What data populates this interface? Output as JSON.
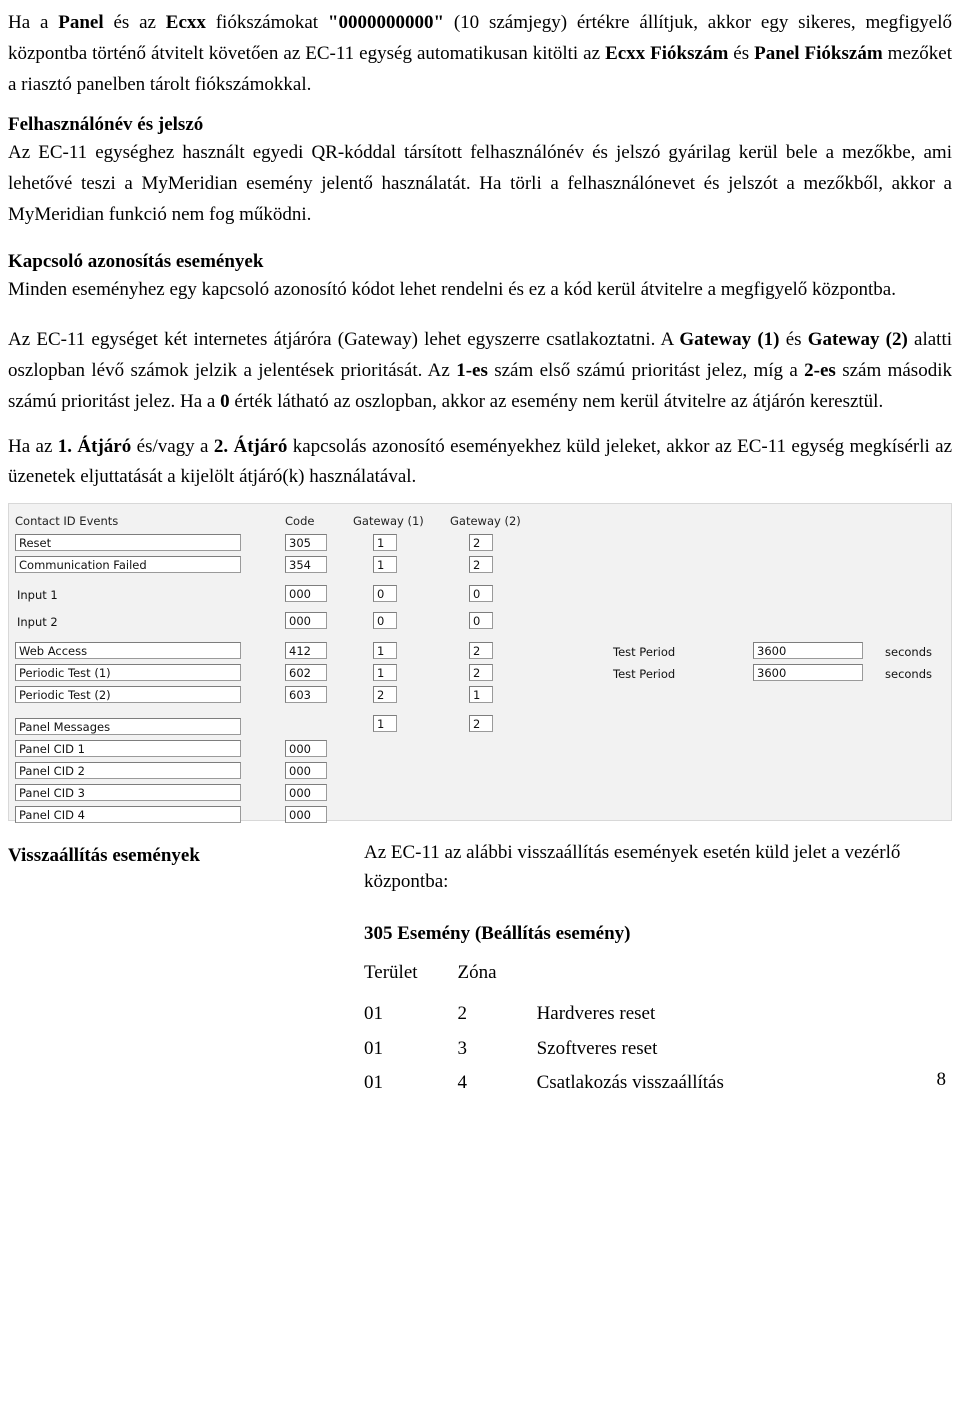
{
  "document": {
    "paragraphs": [
      {
        "id": "p1",
        "html": "Ha a <b>Panel</b> és az <b>Ecxx</b> fiókszámokat <b>\"0000000000\"</b> (10 számjegy) értékre állítjuk, akkor egy sikeres, megfigyelő központba történő átvitelt követően az EC-11 egység automatikusan kitölti az <b>Ecxx Fiókszám</b> és <b>Panel Fiókszám</b> mezőket a riasztó panelben tárolt fiókszámokkal."
      }
    ],
    "headings": {
      "username_password": "Felhasználónév és jelszó",
      "switch_ident_events": "Kapcsoló azonosítás események"
    },
    "sections": {
      "username_password_body": "Az EC-11 egységhez használt egyedi QR-kóddal társított felhasználónév és jelszó gyárilag kerül bele a mezőkbe, ami lehetővé teszi a MyMeridian esemény jelentő használatát. Ha törli a felhasználónevet és jelszót a mezőkből, akkor a MyMeridian funkció nem fog működni.",
      "switch_ident_body": "Minden eseményhez egy kapcsoló azonosító kódot lehet rendelni és ez a kód kerül átvitelre a megfigyelő központba.",
      "gateway_para_html": "Az EC-11 egységet két internetes átjáróra (Gateway) lehet egyszerre csatlakoztatni. A <b>Gateway (1)</b> és <b>Gateway (2)</b> alatti oszlopban lévő számok jelzik a jelentések prioritását. Az <b>1-es</b> szám első számú prioritást jelez, míg a <b>2-es</b> szám második számú prioritást jelez. Ha a <b>0</b> érték látható az oszlopban, akkor az esemény nem kerül átvitelre az átjárón keresztül.",
      "gateway_para2_html": "Ha az <b>1. Átjáró</b> és/vagy a <b>2. Átjáró</b> kapcsolás azonosító eseményekhez küld jeleket, akkor az EC-11 egység megkísérli az üzenetek eljuttatását a kijelölt átjáró(k) használatával."
    }
  },
  "figure": {
    "columns": {
      "contact_id_events": "Contact ID Events",
      "code": "Code",
      "gateway1": "Gateway (1)",
      "gateway2": "Gateway (2)"
    },
    "rows": [
      {
        "label": "Reset",
        "code": "305",
        "g1": "1",
        "g2": "2",
        "boxed": true
      },
      {
        "label": "Communication Failed",
        "code": "354",
        "g1": "1",
        "g2": "2",
        "boxed": true
      },
      {
        "label": "Input 1",
        "code": "000",
        "g1": "0",
        "g2": "0",
        "boxed": false
      },
      {
        "label": "Input 2",
        "code": "000",
        "g1": "0",
        "g2": "0",
        "boxed": false
      },
      {
        "label": "Web Access",
        "code": "412",
        "g1": "1",
        "g2": "2",
        "boxed": true
      },
      {
        "label": "Periodic Test (1)",
        "code": "602",
        "g1": "1",
        "g2": "2",
        "boxed": true
      },
      {
        "label": "Periodic Test (2)",
        "code": "603",
        "g1": "2",
        "g2": "1",
        "boxed": true
      },
      {
        "label": "Panel Messages",
        "code": "",
        "g1": "1",
        "g2": "2",
        "boxed": true
      },
      {
        "label": "Panel CID 1",
        "code": "000",
        "g1": "",
        "g2": "",
        "boxed": true
      },
      {
        "label": "Panel CID 2",
        "code": "000",
        "g1": "",
        "g2": "",
        "boxed": true
      },
      {
        "label": "Panel CID 3",
        "code": "000",
        "g1": "",
        "g2": "",
        "boxed": true
      },
      {
        "label": "Panel CID 4",
        "code": "000",
        "g1": "",
        "g2": "",
        "boxed": true
      }
    ],
    "test_period": {
      "label1": "Test Period",
      "value1": "3600",
      "units1": "seconds",
      "label2": "Test Period",
      "value2": "3600",
      "units2": "seconds"
    }
  },
  "reset_section": {
    "title": "Visszaállítás események",
    "intro": "Az EC-11 az alábbi visszaállítás események esetén küld jelet a vezérlő központba:",
    "subtitle": "305 Esemény (Beállítás esemény)",
    "table": {
      "headers": [
        "Terület",
        "Zóna",
        ""
      ],
      "rows": [
        [
          "01",
          "2",
          "Hardveres reset"
        ],
        [
          "01",
          "3",
          "Szoftveres reset"
        ],
        [
          "01",
          "4",
          "Csatlakozás visszaállítás"
        ]
      ]
    }
  },
  "footer": {
    "page_number": "8"
  }
}
